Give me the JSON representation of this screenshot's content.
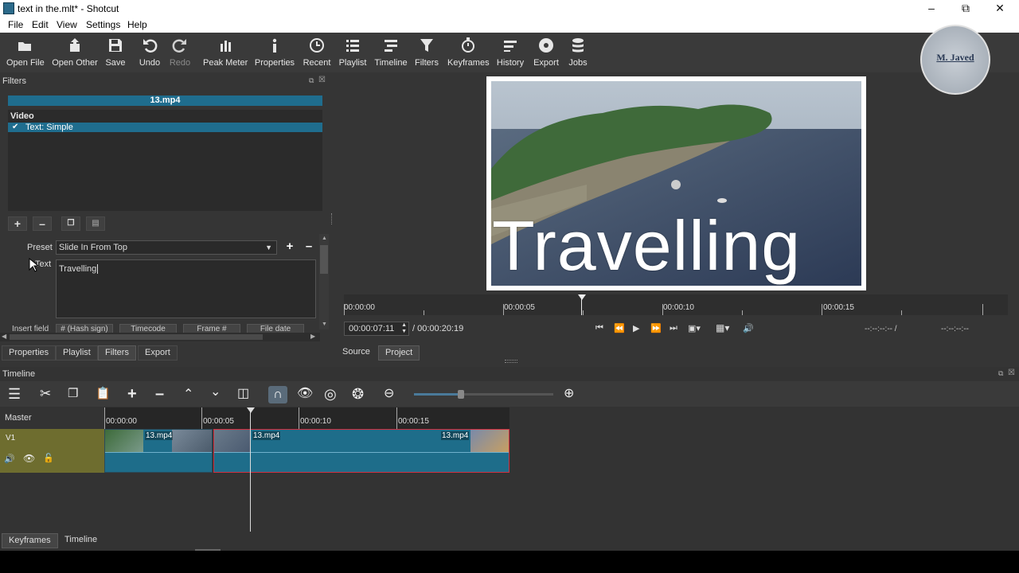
{
  "window": {
    "title": "text in the.mlt* - Shotcut"
  },
  "menu": [
    "File",
    "Edit",
    "View",
    "Settings",
    "Help"
  ],
  "toolbar": [
    {
      "label": "Open File",
      "icon": "open-file-icon"
    },
    {
      "label": "Open Other",
      "icon": "open-other-icon"
    },
    {
      "label": "Save",
      "icon": "save-icon"
    },
    {
      "label": "Undo",
      "icon": "undo-icon"
    },
    {
      "label": "Redo",
      "icon": "redo-icon"
    },
    {
      "label": "Peak Meter",
      "icon": "peak-meter-icon"
    },
    {
      "label": "Properties",
      "icon": "properties-icon"
    },
    {
      "label": "Recent",
      "icon": "recent-icon"
    },
    {
      "label": "Playlist",
      "icon": "playlist-icon"
    },
    {
      "label": "Timeline",
      "icon": "timeline-icon"
    },
    {
      "label": "Filters",
      "icon": "filters-icon"
    },
    {
      "label": "Keyframes",
      "icon": "keyframes-icon"
    },
    {
      "label": "History",
      "icon": "history-icon"
    },
    {
      "label": "Export",
      "icon": "export-icon"
    },
    {
      "label": "Jobs",
      "icon": "jobs-icon"
    }
  ],
  "watermark": {
    "name": "M. Javed"
  },
  "filters": {
    "title": "Filters",
    "clip_name": "13.mp4",
    "section": "Video",
    "items": [
      {
        "label": "Text: Simple",
        "checked": true
      }
    ],
    "preset_label": "Preset",
    "preset_value": "Slide In From Top",
    "text_label": "Text",
    "text_value": "Travelling",
    "insert_field_label": "Insert field",
    "insert_buttons": [
      "# (Hash sign)",
      "Timecode",
      "Frame #",
      "File date"
    ]
  },
  "left_tabs": [
    "Properties",
    "Playlist",
    "Filters",
    "Export"
  ],
  "preview": {
    "overlay_text": "Travelling",
    "ruler_labels": [
      "00:00:00",
      "00:00:05",
      "00:00:10",
      "00:00:15"
    ],
    "current_time": "00:00:07:11",
    "duration": "/ 00:00:20:19",
    "in_point": "--:--:--:-- /",
    "out_point": "--:--:--:--",
    "tabs": [
      "Source",
      "Project"
    ]
  },
  "timeline": {
    "title": "Timeline",
    "master_label": "Master",
    "track_name": "V1",
    "ruler_labels": [
      "00:00:00",
      "00:00:05",
      "00:00:10",
      "00:00:15"
    ],
    "clips": [
      {
        "name": "13.mp4"
      },
      {
        "name": "13.mp4"
      },
      {
        "name": "13.mp4"
      }
    ]
  },
  "bottom_tabs": [
    "Keyframes",
    "Timeline"
  ],
  "colors": {
    "accent": "#1f6d8e",
    "track_header": "#6e6d2f",
    "selected_clip_border": "#d03040"
  }
}
